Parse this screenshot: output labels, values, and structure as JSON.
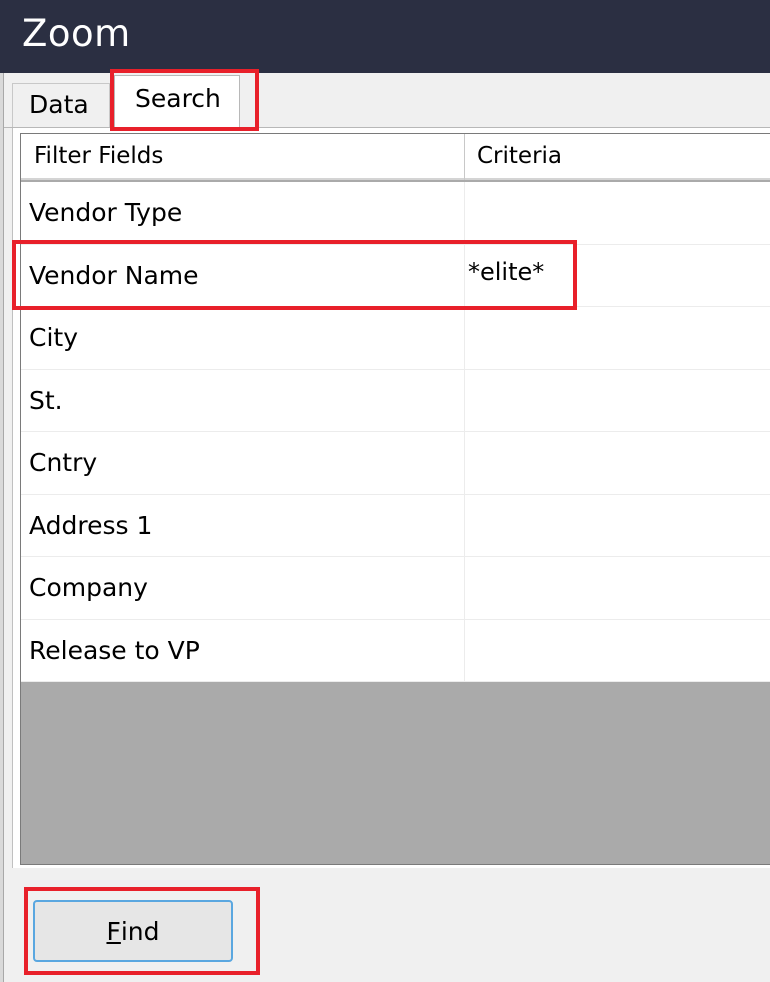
{
  "window": {
    "title": "Zoom"
  },
  "tabs": [
    {
      "label": "Data",
      "active": false
    },
    {
      "label": "Search",
      "active": true
    }
  ],
  "grid": {
    "columns": [
      "Filter Fields",
      "Criteria"
    ],
    "rows": [
      {
        "field": "Vendor Type",
        "criteria": ""
      },
      {
        "field": "Vendor Name",
        "criteria": "*elite*"
      },
      {
        "field": "City",
        "criteria": ""
      },
      {
        "field": "St.",
        "criteria": ""
      },
      {
        "field": "Cntry",
        "criteria": ""
      },
      {
        "field": "Address 1",
        "criteria": ""
      },
      {
        "field": "Company",
        "criteria": ""
      },
      {
        "field": "Release to VP",
        "criteria": ""
      }
    ]
  },
  "find_button": {
    "accel": "F",
    "rest": "ind"
  },
  "colors": {
    "titlebar": "#2b2f42",
    "highlight": "#e8202a",
    "grid_empty": "#aaaaaa",
    "button_focus": "#5aa7e0"
  }
}
